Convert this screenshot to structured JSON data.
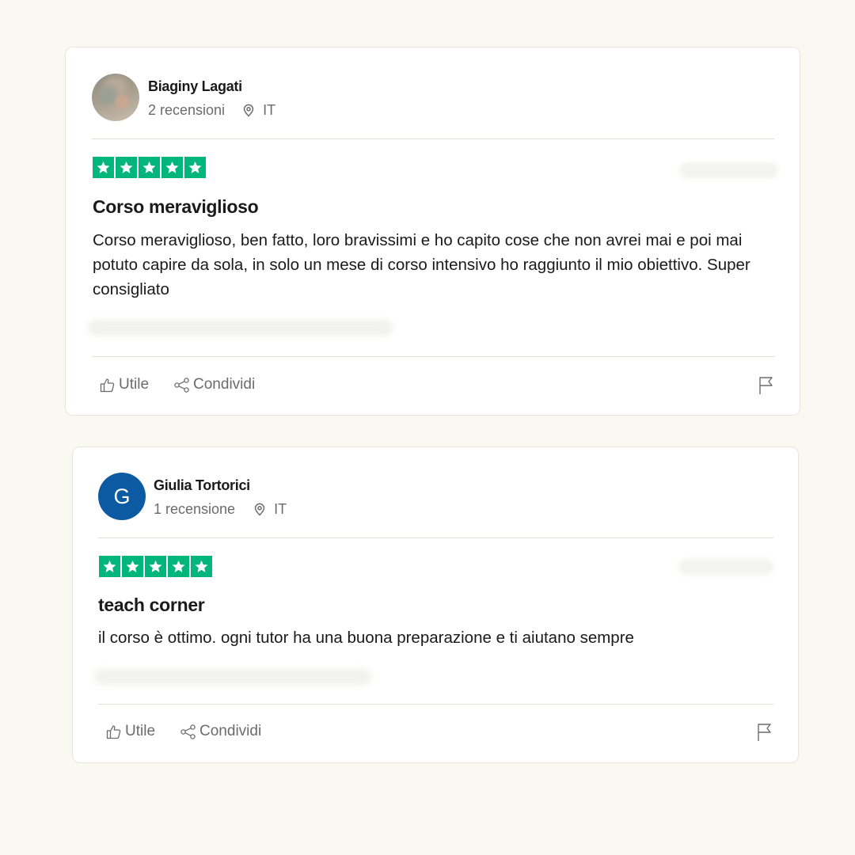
{
  "colors": {
    "background": "#f9f8f1",
    "star_green": "#00b67a",
    "avatar_blue": "#0b5aa2",
    "muted_text": "#6b6b6b"
  },
  "reviews": [
    {
      "reviewer": {
        "name": "Biaginy Lagati",
        "review_count": "2 recensioni",
        "country": "IT",
        "avatar": "photo"
      },
      "rating": 5,
      "title": "Corso meraviglioso",
      "body": "Corso meraviglioso, ben fatto, loro bravissimi e ho capito cose che non avrei mai e poi mai potuto capire da sola, in solo un mese di corso intensivo ho raggiunto il mio obiettivo. Super consigliato",
      "actions": {
        "helpful_label": "Utile",
        "share_label": "Condividi"
      }
    },
    {
      "reviewer": {
        "name": "Giulia Tortorici",
        "review_count": "1 recensione",
        "country": "IT",
        "avatar_initial": "G"
      },
      "rating": 5,
      "title": "teach corner",
      "body": "il corso è ottimo. ogni tutor ha una buona preparazione e ti aiutano sempre",
      "actions": {
        "helpful_label": "Utile",
        "share_label": "Condividi"
      }
    }
  ],
  "icons": {
    "location": "location-pin-icon",
    "helpful": "thumbs-up-icon",
    "share": "share-icon",
    "report": "flag-icon",
    "star": "star-icon"
  }
}
